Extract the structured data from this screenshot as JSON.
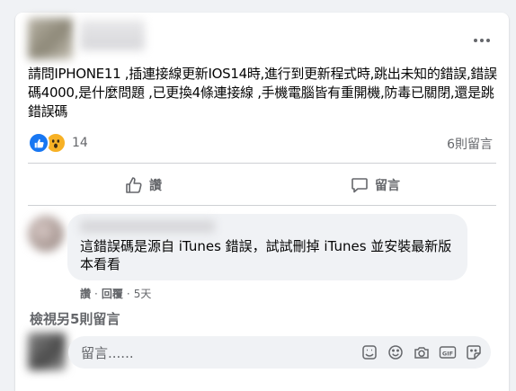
{
  "post": {
    "more_icon": "more-horizontal-icon",
    "text": "請問IPHONE11 ,插連接線更新IOS14時,進行到更新程式時,跳出未知的錯誤,錯誤碼4000,是什麼問題 ,已更換4條連接線 ,手機電腦皆有重開機,防毒已關閉,還是跳錯誤碼",
    "reaction_icons": [
      "like-icon",
      "wow-icon"
    ],
    "reaction_count": "14",
    "comment_count": "6則留言"
  },
  "actions": {
    "like_label": "讚",
    "comment_label": "留言"
  },
  "comment": {
    "text": "這錯誤碼是源自 iTunes 錯誤，試試刪掉 iTunes 並安裝最新版本看看",
    "like_label": "讚",
    "reply_label": "回覆",
    "time": "5天"
  },
  "view_more_comments": "檢視另5則留言",
  "composer": {
    "placeholder": "留言......",
    "tool_icons": [
      "sticker-tag-icon",
      "emoji-icon",
      "camera-icon",
      "gif-icon",
      "sticker-icon"
    ]
  },
  "colors": {
    "background": "#f0f2f5",
    "card": "#ffffff",
    "secondary_text": "#65676b",
    "like_blue": "#1877f2",
    "wow_yellow": "#f7b125"
  }
}
